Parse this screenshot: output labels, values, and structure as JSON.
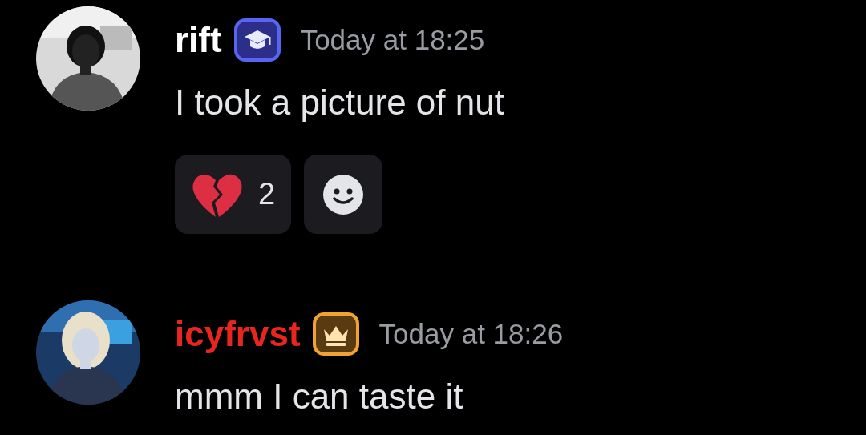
{
  "messages": [
    {
      "username": "rift",
      "color": "#ffffff",
      "badge": {
        "kind": "cap"
      },
      "timestamp": "Today at 18:25",
      "text": "I took a picture of nut",
      "reactions": [
        {
          "kind": "broken-heart",
          "count": "2"
        },
        {
          "kind": "add"
        }
      ]
    },
    {
      "username": "icyfrvst",
      "color": "#e8261e",
      "badge": {
        "kind": "crown"
      },
      "timestamp": "Today at 18:26",
      "text": "mmm I can taste it"
    }
  ]
}
